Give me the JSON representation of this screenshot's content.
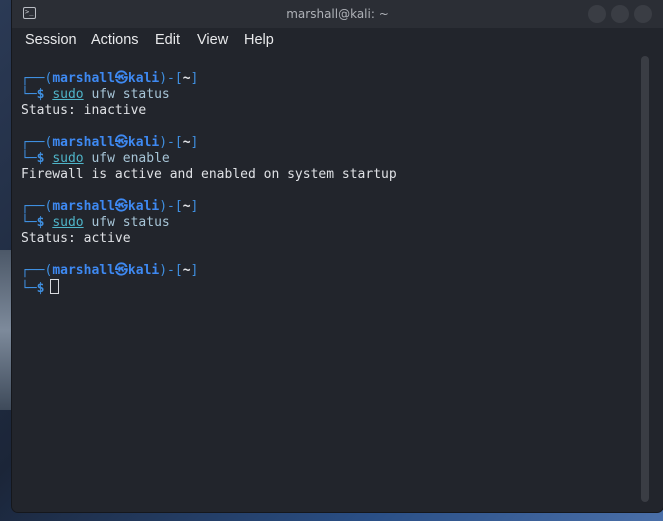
{
  "window": {
    "title": "marshall@kali: ~",
    "app_icon_glyph": ">_"
  },
  "menu": {
    "items": [
      "Session",
      "Actions",
      "Edit",
      "View",
      "Help"
    ]
  },
  "terminal": {
    "prompt": {
      "open": "┌──(",
      "user_host": "marshall㉿kali",
      "mid": ")-[",
      "cwd": "~",
      "close": "]",
      "second_line": "└─",
      "dollar": "$"
    },
    "blocks": [
      {
        "sudo": "sudo",
        "command": " ufw status",
        "output": "Status: inactive"
      },
      {
        "sudo": "sudo",
        "command": " ufw enable",
        "output": "Firewall is active and enabled on system startup"
      },
      {
        "sudo": "sudo",
        "command": " ufw status",
        "output": "Status: active"
      }
    ]
  },
  "colors": {
    "prompt_blue": "#3e89f2",
    "command_cyan": "#4fb5c9",
    "background": "#22252c"
  }
}
